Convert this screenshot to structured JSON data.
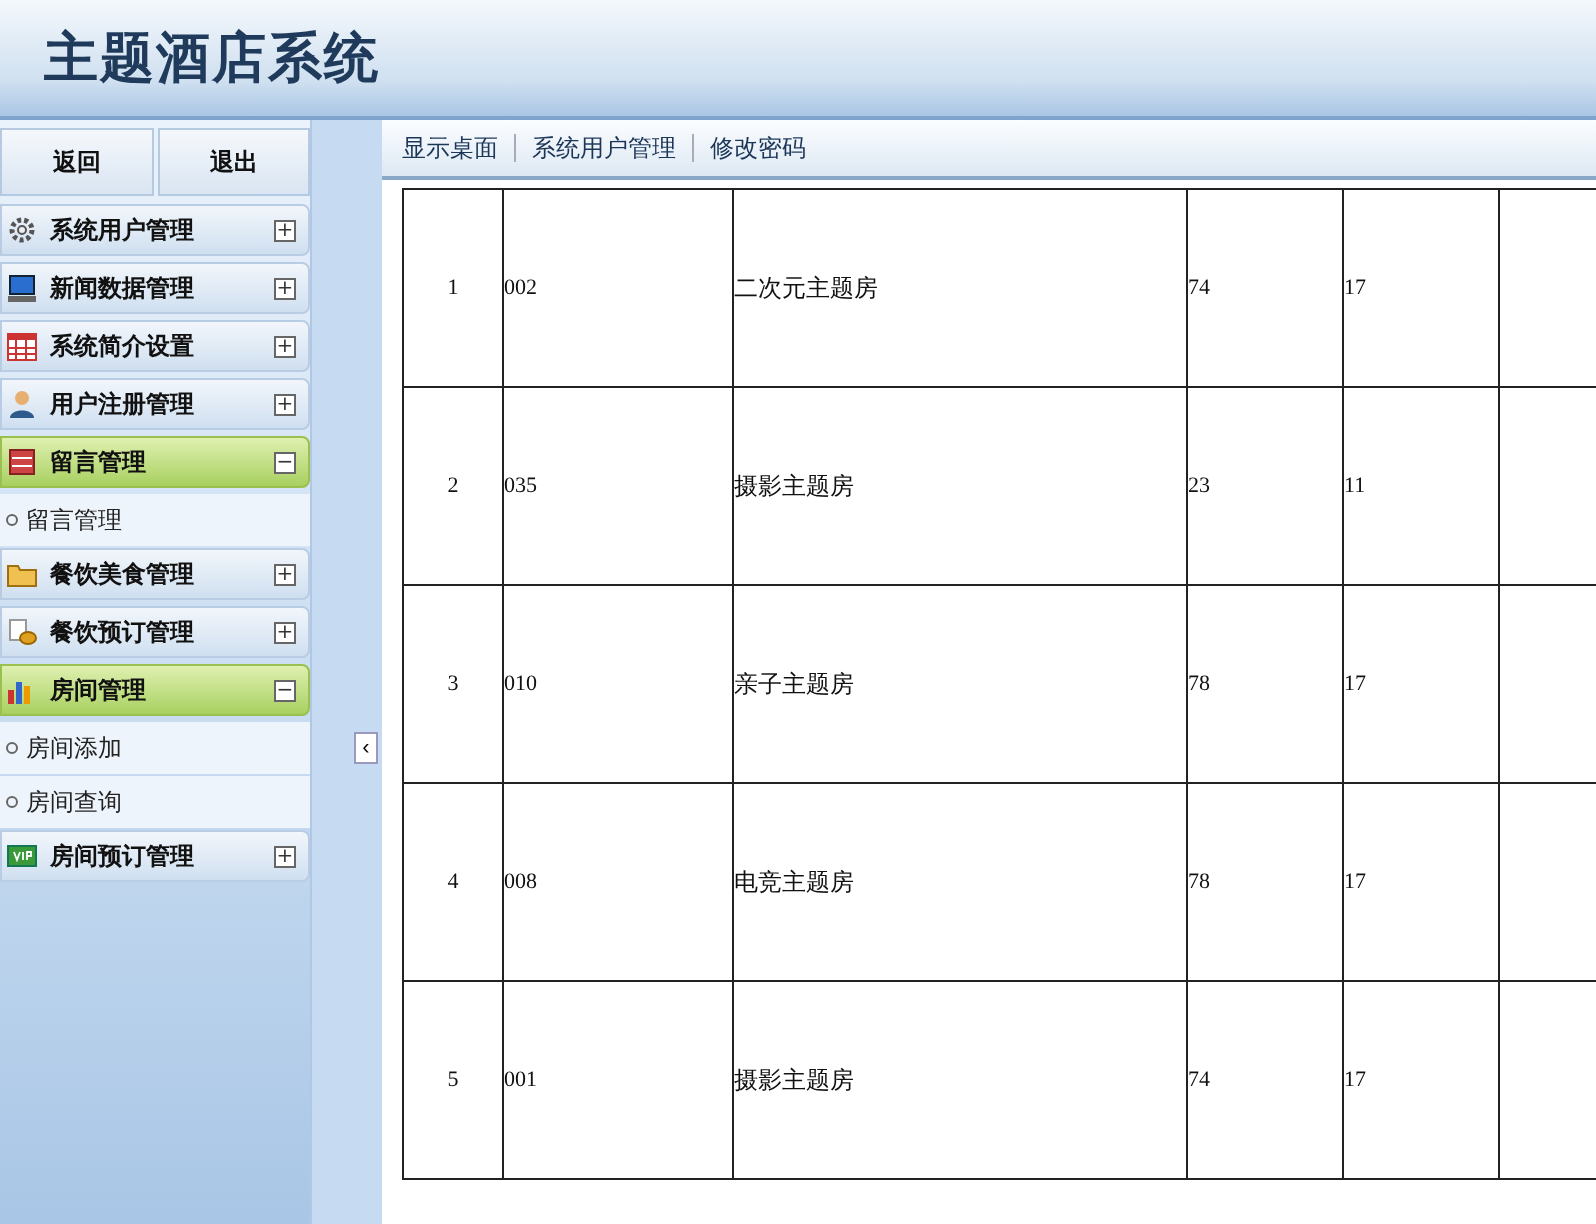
{
  "header": {
    "title": "主题酒店系统"
  },
  "sidebar": {
    "buttons": [
      "返回",
      "退出"
    ],
    "groups": [
      {
        "label": "系统用户管理",
        "expanded": false,
        "toggle": "+"
      },
      {
        "label": "新闻数据管理",
        "expanded": false,
        "toggle": "+"
      },
      {
        "label": "系统简介设置",
        "expanded": false,
        "toggle": "+"
      },
      {
        "label": "用户注册管理",
        "expanded": false,
        "toggle": "+"
      },
      {
        "label": "留言管理",
        "expanded": true,
        "toggle": "−",
        "children": [
          "留言管理"
        ]
      },
      {
        "label": "餐饮美食管理",
        "expanded": false,
        "toggle": "+"
      },
      {
        "label": "餐饮预订管理",
        "expanded": false,
        "toggle": "+"
      },
      {
        "label": "房间管理",
        "expanded": true,
        "toggle": "−",
        "children": [
          "房间添加",
          "房间查询"
        ]
      },
      {
        "label": "房间预订管理",
        "expanded": false,
        "toggle": "+"
      }
    ],
    "collapse": "‹"
  },
  "breadcrumb": [
    "显示桌面",
    "系统用户管理",
    "修改密码"
  ],
  "table": {
    "rows": [
      [
        "1",
        "002",
        "二次元主题房",
        "74",
        "17"
      ],
      [
        "2",
        "035",
        "摄影主题房",
        "23",
        "11"
      ],
      [
        "3",
        "010",
        "亲子主题房",
        "78",
        "17"
      ],
      [
        "4",
        "008",
        "电竞主题房",
        "78",
        "17"
      ],
      [
        "5",
        "001",
        "摄影主题房",
        "74",
        "17"
      ]
    ]
  }
}
